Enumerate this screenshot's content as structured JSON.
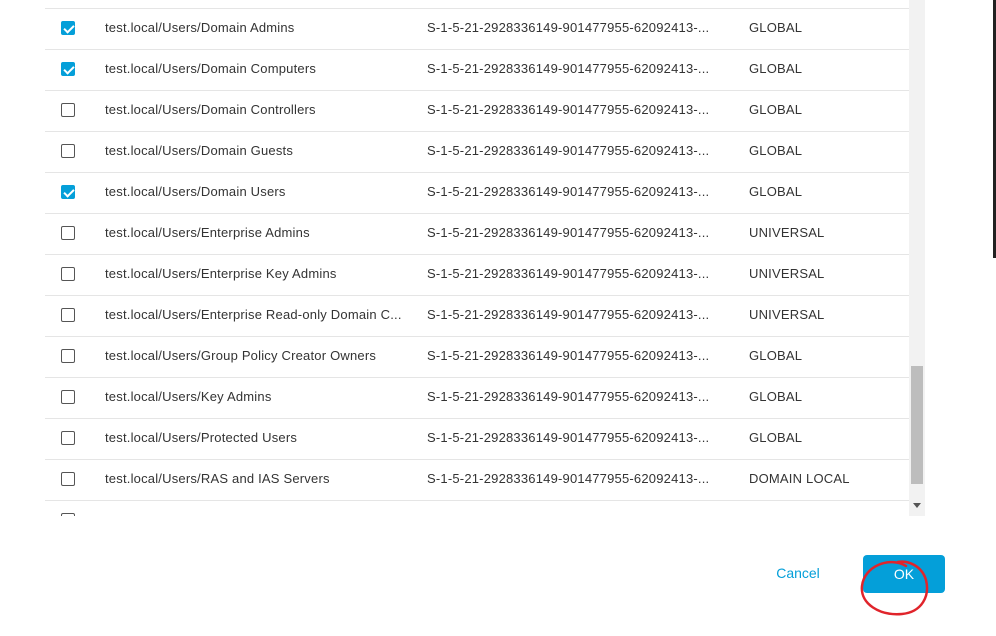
{
  "table": {
    "rows": [
      {
        "checked": true,
        "name": "test.local/Users/Domain Admins",
        "sid": "S-1-5-21-2928336149-901477955-62092413-...",
        "type": "GLOBAL"
      },
      {
        "checked": true,
        "name": "test.local/Users/Domain Computers",
        "sid": "S-1-5-21-2928336149-901477955-62092413-...",
        "type": "GLOBAL"
      },
      {
        "checked": false,
        "name": "test.local/Users/Domain Controllers",
        "sid": "S-1-5-21-2928336149-901477955-62092413-...",
        "type": "GLOBAL"
      },
      {
        "checked": false,
        "name": "test.local/Users/Domain Guests",
        "sid": "S-1-5-21-2928336149-901477955-62092413-...",
        "type": "GLOBAL"
      },
      {
        "checked": true,
        "name": "test.local/Users/Domain Users",
        "sid": "S-1-5-21-2928336149-901477955-62092413-...",
        "type": "GLOBAL"
      },
      {
        "checked": false,
        "name": "test.local/Users/Enterprise Admins",
        "sid": "S-1-5-21-2928336149-901477955-62092413-...",
        "type": "UNIVERSAL"
      },
      {
        "checked": false,
        "name": "test.local/Users/Enterprise Key Admins",
        "sid": "S-1-5-21-2928336149-901477955-62092413-...",
        "type": "UNIVERSAL"
      },
      {
        "checked": false,
        "name": "test.local/Users/Enterprise Read-only Domain C...",
        "sid": "S-1-5-21-2928336149-901477955-62092413-...",
        "type": "UNIVERSAL"
      },
      {
        "checked": false,
        "name": "test.local/Users/Group Policy Creator Owners",
        "sid": "S-1-5-21-2928336149-901477955-62092413-...",
        "type": "GLOBAL"
      },
      {
        "checked": false,
        "name": "test.local/Users/Key Admins",
        "sid": "S-1-5-21-2928336149-901477955-62092413-...",
        "type": "GLOBAL"
      },
      {
        "checked": false,
        "name": "test.local/Users/Protected Users",
        "sid": "S-1-5-21-2928336149-901477955-62092413-...",
        "type": "GLOBAL"
      },
      {
        "checked": false,
        "name": "test.local/Users/RAS and IAS Servers",
        "sid": "S-1-5-21-2928336149-901477955-62092413-...",
        "type": "DOMAIN LOCAL"
      },
      {
        "checked": false,
        "name": "",
        "sid": "",
        "type": ""
      }
    ]
  },
  "footer": {
    "cancel_label": "Cancel",
    "ok_label": "OK"
  },
  "colors": {
    "accent": "#049fd9",
    "annotation": "#e0242b"
  },
  "icons": {
    "checkbox": "checkbox-icon",
    "scroll_down": "scroll-down-arrow-icon"
  }
}
